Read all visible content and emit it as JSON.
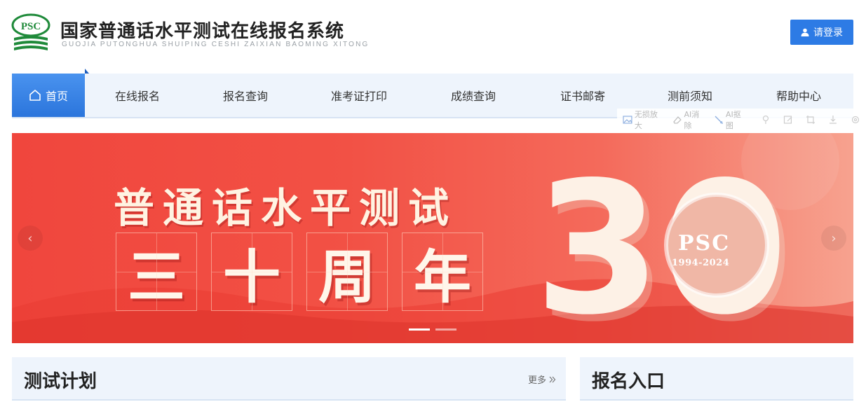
{
  "header": {
    "logo_text": "PSC",
    "title_cn": "国家普通话水平测试在线报名系统",
    "title_en": "GUOJIA PUTONGHUA SHUIPING CESHI ZAIXIAN BAOMING XITONG",
    "login_label": "请登录",
    "login_icon": "user-icon",
    "brand_color": "#2d7be5"
  },
  "nav": {
    "items": [
      {
        "label": "首页",
        "active": true
      },
      {
        "label": "在线报名"
      },
      {
        "label": "报名查询"
      },
      {
        "label": "准考证打印"
      },
      {
        "label": "成绩查询"
      },
      {
        "label": "证书邮寄"
      },
      {
        "label": "测前须知"
      },
      {
        "label": "帮助中心"
      }
    ],
    "home_icon": "home-icon"
  },
  "toolbar": {
    "items": [
      {
        "label": "无损放大",
        "icon": "image-icon"
      },
      {
        "label": "AI消除",
        "icon": "eraser-icon"
      },
      {
        "label": "AI抠图",
        "icon": "brush-icon"
      }
    ],
    "extra_icons": [
      "pin-icon",
      "edit-icon",
      "crop-icon",
      "download-icon",
      "settings-icon"
    ]
  },
  "banner": {
    "headline": "普通话水平测试",
    "big_chars": [
      "三",
      "十",
      "周",
      "年"
    ],
    "number": "30",
    "psc_label": "PSC",
    "psc_years": "1994-2024",
    "slides": 2,
    "active_slide": 1
  },
  "sections": {
    "test_plan_title": "测试计划",
    "more_label": "更多",
    "register_entry_title": "报名入口"
  }
}
